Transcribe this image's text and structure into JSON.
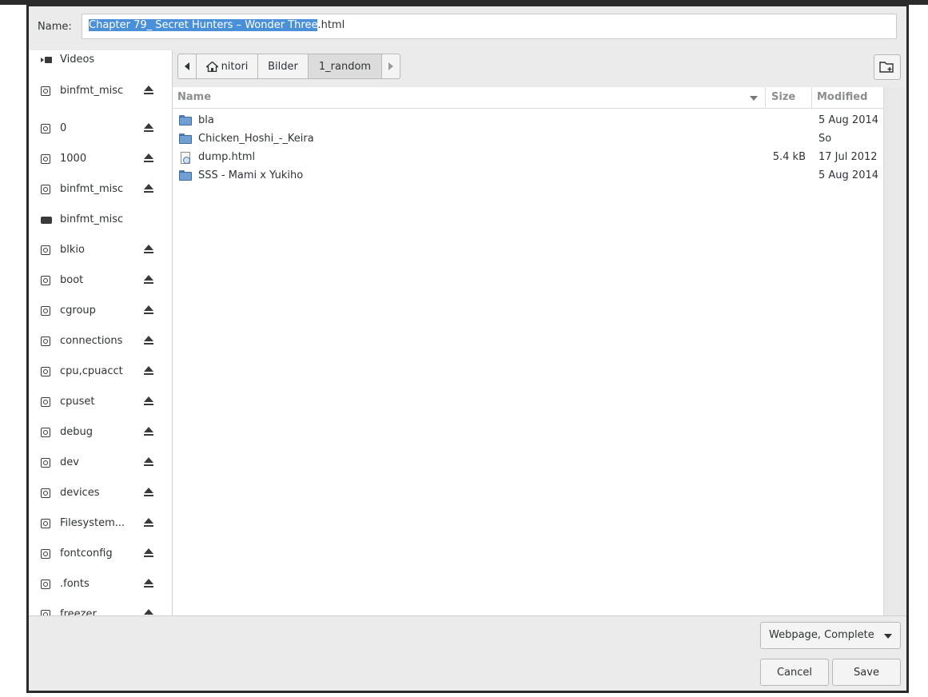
{
  "dialog": {
    "name_label": "Name:",
    "filename_selected": "Chapter 79_ Secret Hunters – Wonder Three",
    "filename_rest": ".html"
  },
  "sidebar": {
    "items": [
      {
        "label": "Videos",
        "icon": "video-icon",
        "eject": false
      },
      {
        "label": "binfmt_misc",
        "icon": "disk-icon",
        "eject": true
      },
      {
        "label": "0",
        "icon": "disk-icon",
        "eject": true
      },
      {
        "label": "1000",
        "icon": "disk-icon",
        "eject": true
      },
      {
        "label": "binfmt_misc",
        "icon": "disk-icon",
        "eject": true
      },
      {
        "label": "binfmt_misc",
        "icon": "drive-icon",
        "eject": false
      },
      {
        "label": "blkio",
        "icon": "disk-icon",
        "eject": true
      },
      {
        "label": "boot",
        "icon": "disk-icon",
        "eject": true
      },
      {
        "label": "cgroup",
        "icon": "disk-icon",
        "eject": true
      },
      {
        "label": "connections",
        "icon": "disk-icon",
        "eject": true
      },
      {
        "label": "cpu,cpuacct",
        "icon": "disk-icon",
        "eject": true
      },
      {
        "label": "cpuset",
        "icon": "disk-icon",
        "eject": true
      },
      {
        "label": "debug",
        "icon": "disk-icon",
        "eject": true
      },
      {
        "label": "dev",
        "icon": "disk-icon",
        "eject": true
      },
      {
        "label": "devices",
        "icon": "disk-icon",
        "eject": true
      },
      {
        "label": "Filesystem...",
        "icon": "disk-icon",
        "eject": true
      },
      {
        "label": "fontconfig",
        "icon": "disk-icon",
        "eject": true
      },
      {
        "label": ".fonts",
        "icon": "disk-icon",
        "eject": true
      },
      {
        "label": "freezer",
        "icon": "disk-icon",
        "eject": true
      }
    ]
  },
  "pathbar": {
    "home": "nitori",
    "crumbs": [
      "Bilder",
      "1_random"
    ],
    "active": "1_random"
  },
  "filelist": {
    "columns": {
      "name": "Name",
      "size": "Size",
      "modified": "Modified"
    },
    "rows": [
      {
        "name": "bla",
        "type": "folder",
        "size": "",
        "modified": "5 Aug 2014"
      },
      {
        "name": "Chicken_Hoshi_-_Keira",
        "type": "folder",
        "size": "",
        "modified": "So"
      },
      {
        "name": "dump.html",
        "type": "html-file",
        "size": "5.4 kB",
        "modified": "17 Jul 2012"
      },
      {
        "name": "SSS - Mami x Yukiho",
        "type": "folder",
        "size": "",
        "modified": "5 Aug 2014"
      }
    ]
  },
  "footer": {
    "filetype": "Webpage, Complete",
    "cancel": "Cancel",
    "save": "Save"
  },
  "colors": {
    "selection": "#4a90d9",
    "folder": "#6f9fd3"
  }
}
